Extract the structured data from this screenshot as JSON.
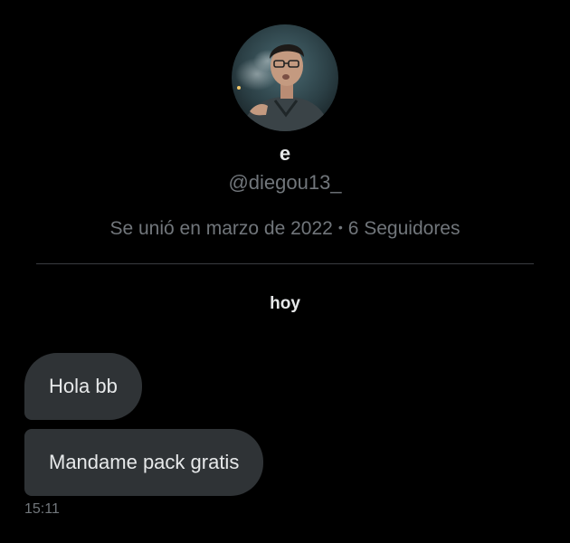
{
  "profile": {
    "display_name": "e",
    "handle": "@diegou13_",
    "joined": "Se unió en marzo de 2022",
    "separator": "•",
    "followers": "6 Seguidores"
  },
  "conversation": {
    "day_label": "hoy",
    "messages": [
      {
        "text": "Hola bb"
      },
      {
        "text": "Mandame pack gratis"
      }
    ],
    "timestamp": "15:11"
  },
  "colors": {
    "background": "#000000",
    "bubble": "#2f3336",
    "primary_text": "#e7e9ea",
    "secondary_text": "#71767b",
    "divider": "#3a3d41"
  }
}
